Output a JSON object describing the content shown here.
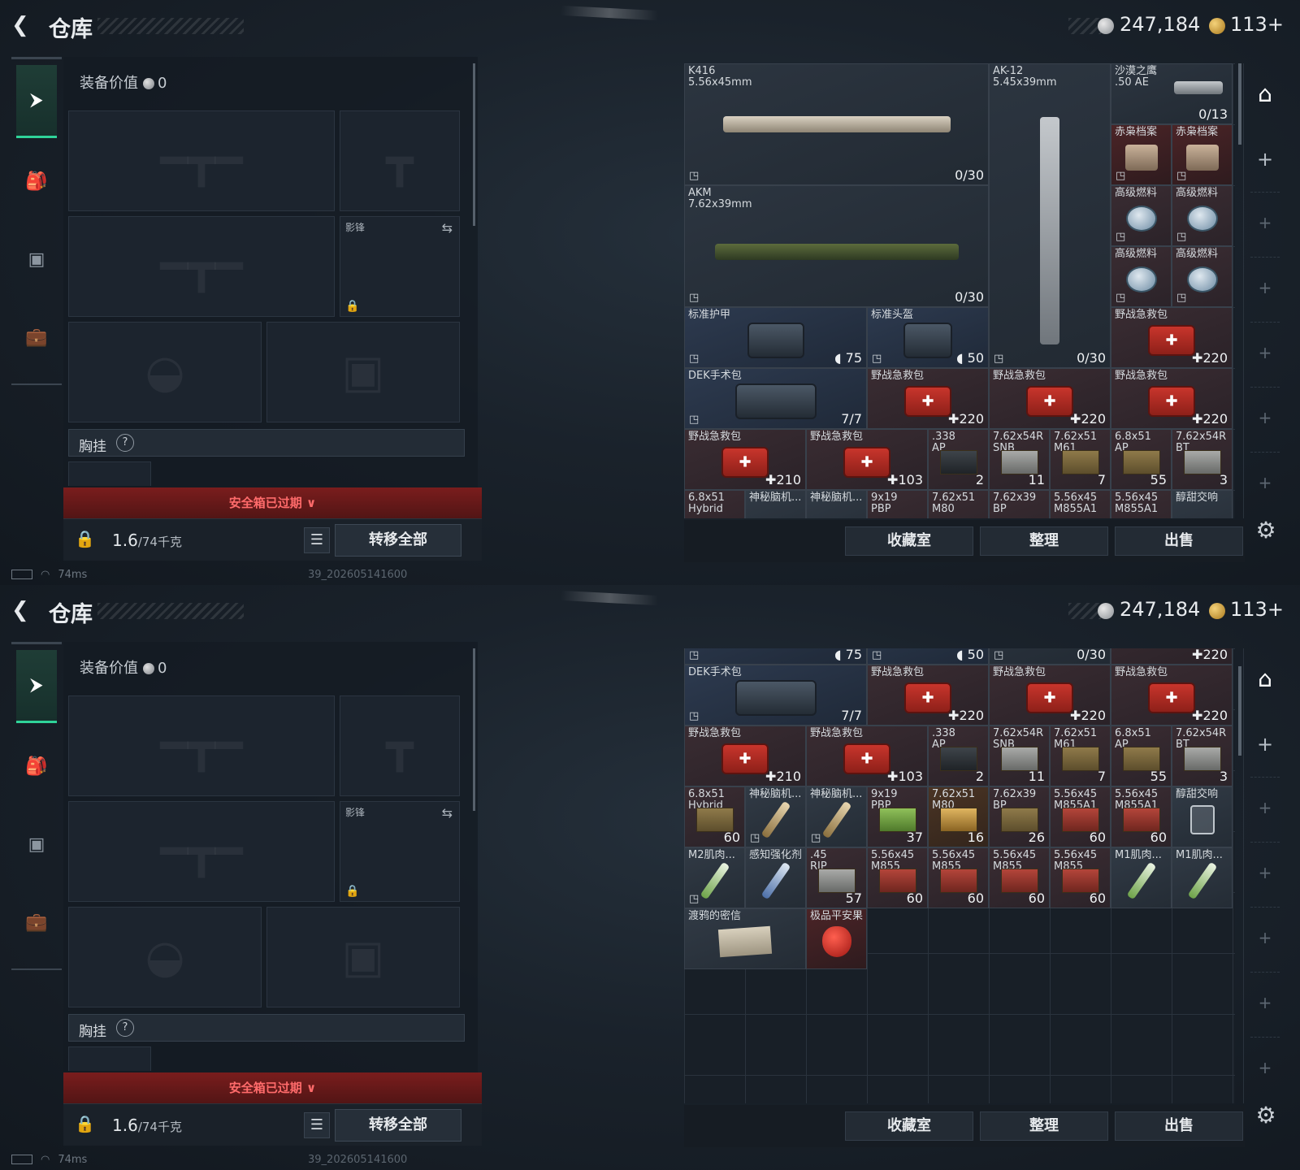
{
  "header": {
    "title": "仓库",
    "silver": "247,184",
    "gold": "113"
  },
  "nav": {
    "items": [
      {
        "name": "weapons",
        "icon": "pistol-icon"
      },
      {
        "name": "backpack",
        "icon": "backpack-icon"
      },
      {
        "name": "rig",
        "icon": "vest-icon"
      },
      {
        "name": "case",
        "icon": "briefcase-icon"
      }
    ]
  },
  "loadout": {
    "value_label": "装备价值",
    "value": "0",
    "secondary_slot_label": "影锋",
    "chest_label": "胸挂",
    "chest_help": "?",
    "safe_expired": "安全箱已过期",
    "weight_value": "1.6",
    "weight_unit": "/74千克",
    "transfer_all": "转移全部"
  },
  "stash": {
    "top": {
      "weapons": [
        {
          "name": "K416\n5.56x45mm",
          "qty": "0/30"
        },
        {
          "name": "AKM\n7.62x39mm",
          "qty": "0/30"
        },
        {
          "name": "AK-12\n5.45x39mm",
          "qty": "0/30"
        },
        {
          "name": "沙漠之鹰\n.50 AE",
          "qty": "0/13"
        }
      ],
      "small": [
        {
          "name": "赤枭档案",
          "qty": ""
        },
        {
          "name": "赤枭档案",
          "qty": ""
        },
        {
          "name": "高级燃料",
          "qty": ""
        },
        {
          "name": "高级燃料",
          "qty": ""
        },
        {
          "name": "高级燃料",
          "qty": ""
        },
        {
          "name": "高级燃料",
          "qty": ""
        }
      ],
      "armor": {
        "name": "标准护甲",
        "qty": "75"
      },
      "helmet": {
        "name": "标准头盔",
        "qty": "50"
      },
      "medkits_row1": [
        {
          "name": "野战急救包",
          "qty": "220"
        },
        {
          "name": "野战急救包",
          "qty": "220"
        },
        {
          "name": "野战急救包",
          "qty": "220"
        },
        {
          "name": "野战急救包",
          "qty": "220"
        }
      ],
      "dek": {
        "name": "DEK手术包",
        "qty": "7/7"
      },
      "row_a": [
        {
          "name": "野战急救包",
          "qty": "210"
        },
        {
          "name": "野战急救包",
          "qty": "103"
        },
        {
          "name": ".338\nAP",
          "qty": "2"
        },
        {
          "name": "7.62x54R\nSNB",
          "qty": "11"
        },
        {
          "name": "7.62x51\nM61",
          "qty": "7"
        },
        {
          "name": "6.8x51\nAP",
          "qty": "55"
        },
        {
          "name": "7.62x54R\nBT",
          "qty": "3"
        }
      ],
      "row_b": [
        {
          "name": "6.8x51\nHybrid"
        },
        {
          "name": "神秘脑机..."
        },
        {
          "name": "神秘脑机..."
        },
        {
          "name": "9x19\nPBP"
        },
        {
          "name": "7.62x51\nM80"
        },
        {
          "name": "7.62x39\nBP"
        },
        {
          "name": "5.56x45\nM855A1"
        },
        {
          "name": "5.56x45\nM855A1"
        },
        {
          "name": "醇甜交响"
        }
      ]
    },
    "bottom": {
      "peek": {
        "armor": "75",
        "helmet": "50",
        "ak": "0/30",
        "med": "220"
      },
      "row_b": [
        {
          "name": "6.8x51\nHybrid",
          "qty": "60"
        },
        {
          "name": "神秘脑机...",
          "qty": ""
        },
        {
          "name": "神秘脑机...",
          "qty": ""
        },
        {
          "name": "9x19\nPBP",
          "qty": "37"
        },
        {
          "name": "7.62x51\nM80",
          "qty": "16"
        },
        {
          "name": "7.62x39\nBP",
          "qty": "26"
        },
        {
          "name": "5.56x45\nM855A1",
          "qty": "60"
        },
        {
          "name": "5.56x45\nM855A1",
          "qty": "60"
        },
        {
          "name": "醇甜交响",
          "qty": ""
        }
      ],
      "row_c": [
        {
          "name": "M2肌肉...",
          "qty": ""
        },
        {
          "name": "感知强化剂",
          "qty": ""
        },
        {
          "name": ".45\nRIP",
          "qty": "57"
        },
        {
          "name": "5.56x45\nM855",
          "qty": "60"
        },
        {
          "name": "5.56x45\nM855",
          "qty": "60"
        },
        {
          "name": "5.56x45\nM855",
          "qty": "60"
        },
        {
          "name": "5.56x45\nM855",
          "qty": "60"
        },
        {
          "name": "M1肌肉...",
          "qty": ""
        },
        {
          "name": "M1肌肉...",
          "qty": ""
        }
      ],
      "row_d": [
        {
          "name": "渡鸦的密信",
          "qty": ""
        },
        {
          "name": "极品平安果",
          "qty": ""
        }
      ]
    }
  },
  "actions": {
    "collection": "收藏室",
    "sort": "整理",
    "sell": "出售"
  },
  "status": {
    "ping": "74ms",
    "build": "39_202605141600"
  }
}
